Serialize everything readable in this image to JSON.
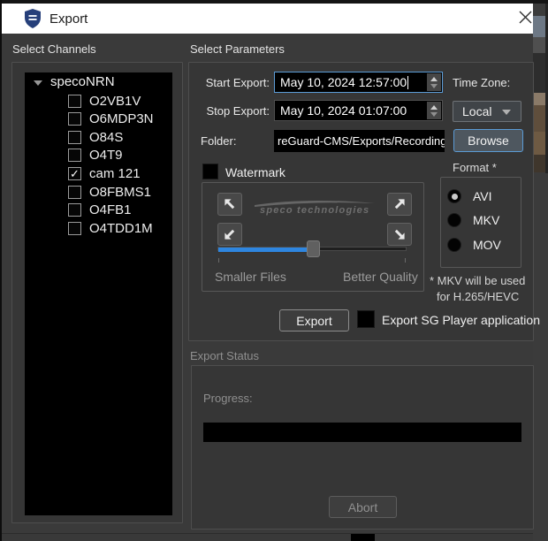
{
  "window": {
    "title": "Export"
  },
  "channels": {
    "section_label": "Select Channels",
    "tree_root": "specoNRN",
    "items": [
      {
        "label": "O2VB1V",
        "checked": false
      },
      {
        "label": "O6MDP3N",
        "checked": false
      },
      {
        "label": "O84S",
        "checked": false
      },
      {
        "label": "O4T9",
        "checked": false
      },
      {
        "label": "cam 121",
        "checked": true
      },
      {
        "label": "O8FBMS1",
        "checked": false
      },
      {
        "label": "O4FB1",
        "checked": false
      },
      {
        "label": "O4TDD1M",
        "checked": false
      }
    ]
  },
  "parameters": {
    "section_label": "Select Parameters",
    "start_label": "Start Export:",
    "start_value": "May 10, 2024 12:57:00",
    "stop_label": "Stop Export:",
    "stop_value": "May 10, 2024 01:07:00",
    "timezone_label": "Time Zone:",
    "timezone_value": "Local",
    "folder_label": "Folder:",
    "folder_value": "reGuard-CMS/Exports/Recordings",
    "browse_label": "Browse",
    "watermark_label": "Watermark",
    "watermark_logo_text": "speco technologies",
    "slider_left_label": "Smaller Files",
    "slider_right_label": "Better Quality",
    "format_label": "Format *",
    "formats": [
      {
        "label": "AVI",
        "selected": true
      },
      {
        "label": "MKV",
        "selected": false
      },
      {
        "label": "MOV",
        "selected": false
      }
    ],
    "format_note_line1": "* MKV will be used",
    "format_note_line2": "for H.265/HEVC",
    "export_button": "Export",
    "sg_player_label": "Export SG Player application",
    "sg_player_checked": false,
    "watermark_checked": false
  },
  "status": {
    "section_label": "Export Status",
    "progress_label": "Progress:",
    "abort_button": "Abort"
  },
  "colors": {
    "body": "#3a3a3a",
    "accent_blue": "#2e86e0",
    "focus_blue": "#5b9bd5",
    "shield_navy": "#263f7a"
  }
}
